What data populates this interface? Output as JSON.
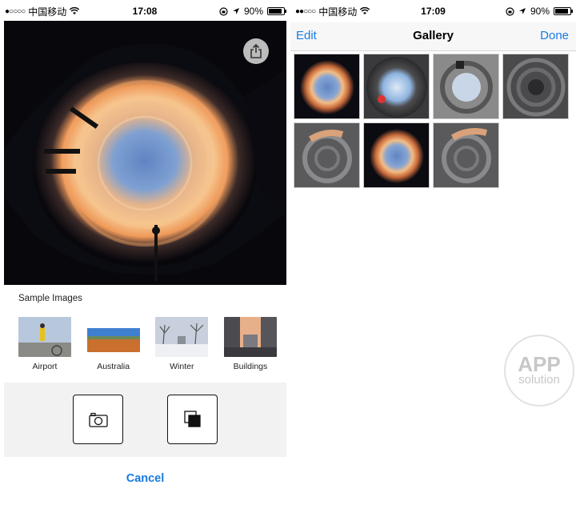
{
  "left_status": {
    "carrier": "中国移动",
    "time": "17:08",
    "battery": "90%"
  },
  "right_status": {
    "carrier": "中国移动",
    "time": "17:09",
    "battery": "90%"
  },
  "editor": {
    "samples_title": "Sample Images",
    "samples": [
      {
        "label": "Airport"
      },
      {
        "label": "Australia"
      },
      {
        "label": "Winter"
      },
      {
        "label": "Buildings"
      }
    ],
    "camera_icon": "camera-icon",
    "library_icon": "photo-library-icon",
    "share_icon": "share-icon",
    "cancel_label": "Cancel"
  },
  "gallery": {
    "edit_label": "Edit",
    "title": "Gallery",
    "done_label": "Done",
    "item_count": 7
  },
  "watermark": {
    "line1": "APP",
    "line2": "solution"
  },
  "colors": {
    "accent": "#1a7ae0"
  }
}
